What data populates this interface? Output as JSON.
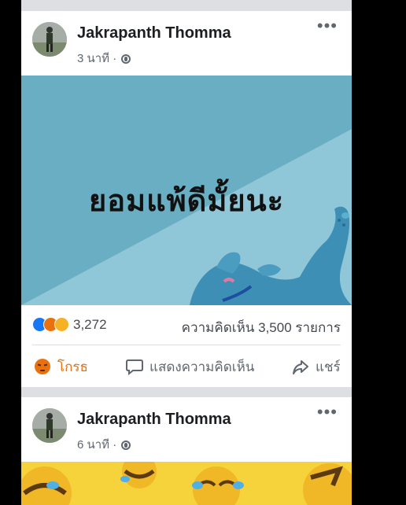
{
  "posts": [
    {
      "author": "Jakrapanth Thomma",
      "time": "3 นาที",
      "separator": "·",
      "privacy_icon": "globe-icon",
      "more_label": "•••",
      "image_text": "ยอมแพ้ดีมั้ยนะ",
      "reaction_icons": [
        "like-icon",
        "angry-icon",
        "haha-icon"
      ],
      "reaction_count": "3,272",
      "comment_count": "ความคิดเห็น 3,500 รายการ",
      "actions": {
        "react_label": "โกรธ",
        "comment_label": "แสดงความคิดเห็น",
        "share_label": "แชร์"
      }
    },
    {
      "author": "Jakrapanth Thomma",
      "time": "6 นาที",
      "separator": "·",
      "privacy_icon": "globe-icon",
      "more_label": "•••"
    }
  ],
  "colors": {
    "image_bg": "#6aaec4",
    "image_light": "#8fc6d8",
    "dog": "#3e8fb5",
    "angry": "#e9710f",
    "like": "#1877f2",
    "emoji_strip": "#f6d33b"
  }
}
